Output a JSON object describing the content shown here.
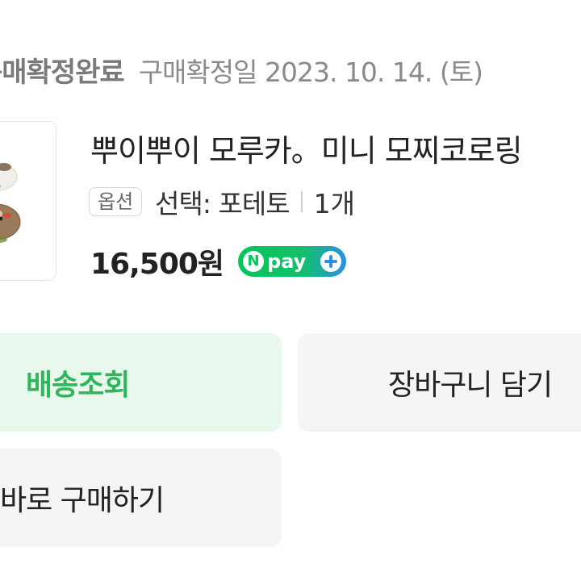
{
  "order": {
    "status": "구매확정완료",
    "confirm_date": "구매확정일 2023. 10. 14. (토)"
  },
  "product": {
    "title": "뿌이뿌이 모루카。미니 모찌코로링",
    "option_badge": "옵션",
    "option_text": "선택: 포테토",
    "quantity": "1개",
    "price": "16,500원",
    "payment": {
      "n": "N",
      "label": "pay"
    }
  },
  "actions": {
    "track_label": "배송조회",
    "cart_label": "장바구니 담기",
    "buy_again_label": "바로 구매하기"
  },
  "colors": {
    "accent_green": "#2fb65b",
    "track_bg": "#e8f8ed",
    "button_bg": "#f4f5f6"
  }
}
